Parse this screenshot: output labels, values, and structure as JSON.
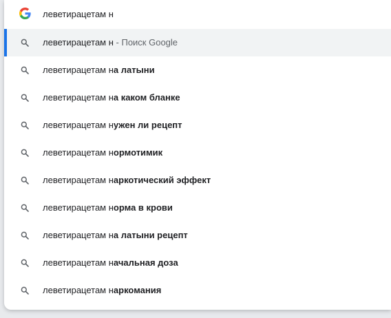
{
  "omnibox": {
    "query": "леветирацетам н"
  },
  "suggestions": [
    {
      "prefix": "леветирацетам н",
      "completion": "",
      "suffix": " - Поиск Google",
      "selected": true
    },
    {
      "prefix": "леветирацетам н",
      "completion": "а латыни",
      "suffix": "",
      "selected": false
    },
    {
      "prefix": "леветирацетам н",
      "completion": "а каком бланке",
      "suffix": "",
      "selected": false
    },
    {
      "prefix": "леветирацетам н",
      "completion": "ужен ли рецепт",
      "suffix": "",
      "selected": false
    },
    {
      "prefix": "леветирацетам н",
      "completion": "ормотимик",
      "suffix": "",
      "selected": false
    },
    {
      "prefix": "леветирацетам н",
      "completion": "аркотический эффект",
      "suffix": "",
      "selected": false
    },
    {
      "prefix": "леветирацетам н",
      "completion": "орма в крови",
      "suffix": "",
      "selected": false
    },
    {
      "prefix": "леветирацетам н",
      "completion": "а латыни рецепт",
      "suffix": "",
      "selected": false
    },
    {
      "prefix": "леветирацетам н",
      "completion": "ачальная доза",
      "suffix": "",
      "selected": false
    },
    {
      "prefix": "леветирацетам н",
      "completion": "аркомания",
      "suffix": "",
      "selected": false
    }
  ],
  "icons": {
    "engine": "google-g-icon",
    "suggestion": "search-icon"
  },
  "colors": {
    "accent": "#1a73e8",
    "selected_bg": "#f1f3f4",
    "text": "#202124",
    "muted": "#5f6368"
  }
}
